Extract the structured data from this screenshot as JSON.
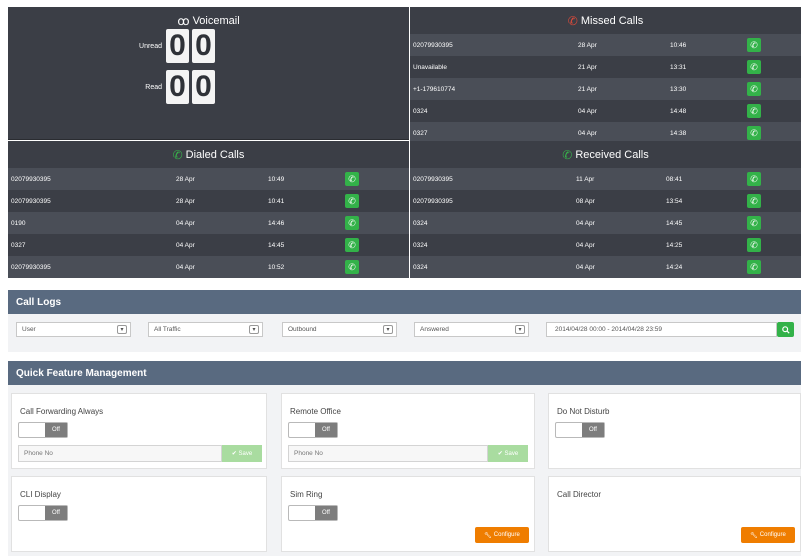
{
  "voicemail": {
    "title": "Voicemail",
    "icon": "voicemail-icon",
    "unread_label": "Unread",
    "unread_digits": [
      "0",
      "0"
    ],
    "read_label": "Read",
    "read_digits": [
      "0",
      "0"
    ]
  },
  "missed": {
    "title": "Missed Calls",
    "icon": "missed-call-icon",
    "rows": [
      {
        "number": "02079930395",
        "date": "28 Apr",
        "time": "10:46"
      },
      {
        "number": "Unavailable",
        "date": "21 Apr",
        "time": "13:31"
      },
      {
        "number": "+1-179610774",
        "date": "21 Apr",
        "time": "13:30"
      },
      {
        "number": "0324",
        "date": "04 Apr",
        "time": "14:48"
      },
      {
        "number": "0327",
        "date": "04 Apr",
        "time": "14:38"
      }
    ]
  },
  "dialed": {
    "title": "Dialed Calls",
    "icon": "outgoing-call-icon",
    "rows": [
      {
        "number": "02079930395",
        "date": "28 Apr",
        "time": "10:49"
      },
      {
        "number": "02079930395",
        "date": "28 Apr",
        "time": "10:41"
      },
      {
        "number": "0190",
        "date": "04 Apr",
        "time": "14:46"
      },
      {
        "number": "0327",
        "date": "04 Apr",
        "time": "14:45"
      },
      {
        "number": "02079930395",
        "date": "04 Apr",
        "time": "10:52"
      }
    ]
  },
  "received": {
    "title": "Received Calls",
    "icon": "incoming-call-icon",
    "rows": [
      {
        "number": "02079930395",
        "date": "11 Apr",
        "time": "08:41"
      },
      {
        "number": "02079930395",
        "date": "08 Apr",
        "time": "13:54"
      },
      {
        "number": "0324",
        "date": "04 Apr",
        "time": "14:45"
      },
      {
        "number": "0324",
        "date": "04 Apr",
        "time": "14:25"
      },
      {
        "number": "0324",
        "date": "04 Apr",
        "time": "14:24"
      }
    ]
  },
  "call_logs": {
    "title": "Call Logs",
    "filters": {
      "user": "User",
      "traffic": "All Traffic",
      "direction": "Outbound",
      "status": "Answered",
      "date_range": "2014/04/28 00:00 - 2014/04/28 23:59"
    }
  },
  "quick_features": {
    "title": "Quick Feature Management",
    "toggle_off": "Off",
    "phone_placeholder": "Phone No",
    "save_label": "Save",
    "configure_label": "Configure",
    "cards": {
      "call_forwarding": "Call Forwarding Always",
      "remote_office": "Remote Office",
      "do_not_disturb": "Do Not Disturb",
      "cli_display": "CLI Display",
      "sim_ring": "Sim Ring",
      "call_director": "Call Director"
    }
  },
  "colors": {
    "panel_bg": "#3b3e46",
    "section_bar": "#596a80",
    "call_button": "#33b249",
    "configure_button": "#ef7d00",
    "missed_icon": "#e04b3b"
  }
}
